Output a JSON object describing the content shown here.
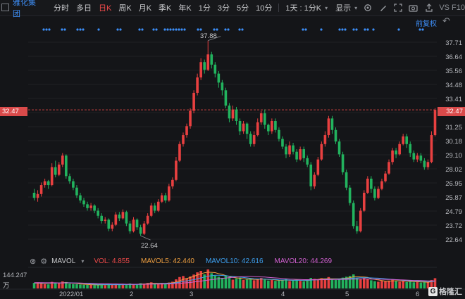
{
  "toolbar": {
    "stock_name": "雅化集团",
    "tabs": [
      "分时",
      "多日",
      "日K",
      "周K",
      "月K",
      "季K",
      "年K",
      "1分",
      "3分",
      "5分",
      "10分"
    ],
    "active_tab": "日K",
    "period_select": "1天 : 1分K",
    "display_menu": "显示",
    "f10_label": "F10",
    "vs_label": "VS"
  },
  "main_chart": {
    "adjust_label": "前复权",
    "price_ticks": [
      "37.71",
      "36.64",
      "35.56",
      "34.48",
      "33.41",
      "32.47",
      "31.25",
      "30.18",
      "29.10",
      "28.02",
      "26.95",
      "25.87",
      "24.79",
      "23.72",
      "22.64"
    ],
    "current_price": "32.47",
    "high_label": "37.88",
    "low_label": "22.64"
  },
  "indicator_bar": {
    "name": "MAVOL",
    "vol_label": "VOL: 4.855",
    "mavol5_label": "MAVOL5: 42.440",
    "mavol10_label": "MAVOL10: 42.616",
    "mavol20_label": "MAVOL20: 44.269",
    "colors": {
      "vol": "#f04a4a",
      "mavol5": "#f0a040",
      "mavol10": "#3da0f0",
      "mavol20": "#d060d0"
    }
  },
  "volume_axis": {
    "top": "144.247",
    "unit": "万"
  },
  "x_axis": [
    "2022/01",
    "2",
    "3",
    "4",
    "5",
    "6"
  ],
  "watermark": "格隆汇",
  "chart_data": {
    "type": "candlestick",
    "ylim": [
      22.1,
      38.3
    ],
    "high": 37.88,
    "low": 22.64,
    "last": 32.47,
    "candles": [
      [
        26.0,
        25.6,
        26.3,
        25.4
      ],
      [
        25.6,
        25.9,
        26.2,
        25.3
      ],
      [
        25.9,
        26.6,
        26.8,
        25.7
      ],
      [
        26.6,
        26.9,
        27.1,
        26.4
      ],
      [
        26.9,
        26.6,
        27.0,
        26.3
      ],
      [
        26.6,
        28.0,
        28.3,
        26.5
      ],
      [
        28.0,
        27.4,
        28.5,
        27.2
      ],
      [
        27.4,
        28.2,
        28.4,
        27.3
      ],
      [
        28.2,
        28.9,
        29.1,
        28.0
      ],
      [
        28.9,
        27.3,
        29.0,
        27.1
      ],
      [
        27.3,
        26.9,
        27.5,
        26.7
      ],
      [
        26.9,
        26.4,
        27.1,
        26.2
      ],
      [
        26.4,
        25.8,
        26.6,
        25.6
      ],
      [
        25.8,
        25.4,
        26.0,
        25.2
      ],
      [
        25.4,
        25.1,
        25.6,
        24.9
      ],
      [
        25.1,
        24.8,
        25.3,
        24.6
      ],
      [
        24.8,
        25.0,
        25.2,
        24.6
      ],
      [
        25.0,
        24.6,
        25.1,
        24.4
      ],
      [
        24.6,
        24.2,
        24.8,
        24.0
      ],
      [
        24.2,
        23.8,
        24.4,
        23.6
      ],
      [
        23.8,
        23.9,
        24.1,
        23.6
      ],
      [
        23.9,
        23.2,
        24.0,
        23.0
      ],
      [
        23.2,
        23.5,
        23.7,
        23.0
      ],
      [
        23.5,
        24.3,
        24.5,
        23.4
      ],
      [
        24.3,
        24.0,
        24.5,
        23.8
      ],
      [
        24.0,
        24.5,
        24.7,
        23.9
      ],
      [
        24.5,
        23.6,
        24.6,
        23.4
      ],
      [
        23.6,
        23.0,
        23.8,
        22.8
      ],
      [
        23.0,
        23.9,
        24.1,
        22.9
      ],
      [
        23.9,
        23.3,
        24.0,
        23.1
      ],
      [
        23.3,
        22.8,
        23.5,
        22.64
      ],
      [
        22.8,
        23.6,
        23.8,
        22.7
      ],
      [
        23.6,
        24.2,
        24.4,
        23.5
      ],
      [
        24.2,
        25.0,
        25.2,
        24.1
      ],
      [
        25.0,
        24.6,
        25.2,
        24.4
      ],
      [
        24.6,
        25.3,
        25.5,
        24.5
      ],
      [
        25.3,
        25.8,
        26.0,
        25.2
      ],
      [
        25.8,
        25.4,
        26.0,
        25.2
      ],
      [
        25.4,
        26.5,
        26.7,
        25.3
      ],
      [
        26.5,
        27.0,
        27.2,
        26.3
      ],
      [
        27.0,
        28.5,
        28.8,
        26.9
      ],
      [
        28.5,
        29.8,
        30.0,
        28.4
      ],
      [
        29.8,
        30.5,
        30.7,
        29.6
      ],
      [
        30.5,
        31.2,
        31.4,
        30.3
      ],
      [
        31.2,
        32.4,
        32.6,
        31.0
      ],
      [
        32.4,
        33.8,
        34.0,
        32.2
      ],
      [
        33.8,
        35.0,
        35.3,
        33.6
      ],
      [
        35.0,
        36.2,
        36.5,
        34.8
      ],
      [
        36.2,
        35.6,
        36.4,
        35.3
      ],
      [
        35.6,
        36.8,
        37.88,
        35.5
      ],
      [
        36.8,
        36.0,
        37.0,
        35.7
      ],
      [
        36.0,
        35.3,
        36.2,
        35.0
      ],
      [
        35.3,
        34.6,
        35.5,
        34.2
      ],
      [
        34.6,
        34.0,
        34.8,
        33.6
      ],
      [
        34.0,
        32.8,
        34.2,
        32.6
      ],
      [
        32.8,
        31.8,
        33.0,
        31.5
      ],
      [
        31.8,
        32.5,
        32.8,
        31.6
      ],
      [
        32.5,
        31.6,
        32.7,
        31.3
      ],
      [
        31.6,
        30.8,
        31.8,
        30.5
      ],
      [
        30.8,
        31.4,
        31.6,
        30.6
      ],
      [
        31.4,
        30.6,
        31.5,
        30.2
      ],
      [
        30.6,
        29.8,
        30.8,
        29.6
      ],
      [
        29.8,
        30.5,
        30.8,
        29.6
      ],
      [
        30.5,
        31.5,
        31.8,
        30.4
      ],
      [
        31.5,
        32.2,
        32.4,
        31.3
      ],
      [
        32.2,
        31.3,
        32.5,
        31.0
      ],
      [
        31.3,
        30.8,
        31.4,
        30.5
      ],
      [
        30.8,
        31.6,
        31.8,
        30.6
      ],
      [
        31.6,
        30.9,
        31.8,
        30.7
      ],
      [
        30.9,
        30.2,
        31.1,
        30.0
      ],
      [
        30.2,
        29.6,
        30.4,
        29.4
      ],
      [
        29.6,
        29.0,
        29.8,
        28.7
      ],
      [
        29.0,
        29.7,
        30.0,
        28.8
      ],
      [
        29.7,
        29.2,
        29.9,
        29.0
      ],
      [
        29.2,
        28.6,
        29.4,
        28.4
      ],
      [
        28.6,
        29.4,
        29.6,
        28.5
      ],
      [
        29.4,
        28.7,
        29.6,
        28.4
      ],
      [
        28.7,
        28.2,
        28.9,
        28.0
      ],
      [
        28.2,
        26.5,
        28.4,
        26.2
      ],
      [
        26.5,
        27.4,
        27.6,
        26.3
      ],
      [
        27.4,
        28.6,
        28.8,
        27.3
      ],
      [
        28.6,
        29.8,
        30.0,
        28.5
      ],
      [
        29.8,
        30.5,
        30.8,
        29.6
      ],
      [
        30.5,
        31.8,
        32.0,
        30.3
      ],
      [
        31.8,
        30.9,
        32.0,
        30.6
      ],
      [
        30.9,
        30.0,
        31.1,
        29.8
      ],
      [
        30.0,
        29.0,
        30.2,
        28.8
      ],
      [
        29.0,
        27.6,
        29.2,
        27.4
      ],
      [
        27.6,
        26.4,
        27.8,
        26.2
      ],
      [
        26.4,
        25.2,
        26.6,
        25.0
      ],
      [
        25.2,
        23.4,
        25.4,
        23.2
      ],
      [
        23.4,
        23.0,
        23.8,
        22.8
      ],
      [
        23.0,
        24.6,
        24.8,
        22.9
      ],
      [
        24.6,
        26.0,
        26.2,
        24.5
      ],
      [
        26.0,
        27.1,
        27.3,
        25.9
      ],
      [
        27.1,
        26.3,
        27.3,
        26.0
      ],
      [
        26.3,
        25.6,
        26.5,
        25.4
      ],
      [
        25.6,
        26.3,
        26.5,
        25.5
      ],
      [
        26.3,
        26.9,
        27.1,
        26.2
      ],
      [
        26.9,
        27.5,
        27.7,
        26.8
      ],
      [
        27.5,
        28.4,
        28.6,
        27.4
      ],
      [
        28.4,
        29.3,
        29.5,
        28.2
      ],
      [
        29.3,
        29.0,
        29.5,
        28.7
      ],
      [
        29.0,
        29.8,
        30.0,
        28.9
      ],
      [
        29.8,
        30.4,
        30.6,
        29.7
      ],
      [
        30.4,
        29.8,
        30.6,
        29.5
      ],
      [
        29.8,
        29.1,
        30.0,
        28.8
      ],
      [
        29.1,
        28.6,
        29.3,
        28.4
      ],
      [
        28.6,
        28.9,
        29.1,
        28.4
      ],
      [
        28.9,
        28.5,
        29.1,
        28.3
      ],
      [
        28.5,
        28.0,
        28.7,
        27.8
      ],
      [
        28.0,
        28.4,
        28.6,
        27.8
      ],
      [
        28.4,
        30.5,
        30.8,
        28.3
      ],
      [
        30.5,
        32.47,
        32.6,
        30.4
      ]
    ],
    "volumes": [
      38,
      42,
      35,
      30,
      28,
      45,
      40,
      36,
      48,
      44,
      33,
      30,
      29,
      27,
      25,
      24,
      26,
      23,
      25,
      28,
      22,
      30,
      26,
      32,
      28,
      24,
      30,
      34,
      29,
      26,
      36,
      32,
      38,
      42,
      30,
      34,
      38,
      30,
      40,
      46,
      62,
      78,
      85,
      70,
      82,
      95,
      110,
      120,
      96,
      130,
      104,
      88,
      80,
      72,
      90,
      76,
      60,
      68,
      74,
      58,
      62,
      70,
      56,
      64,
      72,
      60,
      54,
      58,
      52,
      56,
      60,
      64,
      50,
      54,
      58,
      52,
      48,
      56,
      72,
      66,
      60,
      70,
      64,
      78,
      62,
      58,
      66,
      74,
      80,
      86,
      96,
      70,
      62,
      74,
      66,
      56,
      50,
      46,
      52,
      48,
      54,
      60,
      50,
      46,
      52,
      44,
      48,
      42,
      46,
      40,
      44,
      42,
      58,
      70
    ],
    "mavol5": [
      36,
      36,
      35,
      35,
      35,
      36,
      38,
      38,
      39,
      41,
      38,
      36,
      34,
      31,
      29,
      27,
      26,
      25,
      24,
      25,
      25,
      26,
      26,
      27,
      27,
      27,
      28,
      28,
      28,
      29,
      30,
      31,
      32,
      34,
      35,
      35,
      35,
      35,
      37,
      38,
      44,
      52,
      62,
      68,
      75,
      82,
      92,
      100,
      107,
      111,
      110,
      108,
      101,
      96,
      88,
      81,
      76,
      72,
      70,
      66,
      64,
      64,
      62,
      62,
      64,
      64,
      61,
      61,
      58,
      56,
      56,
      58,
      56,
      56,
      57,
      56,
      54,
      54,
      57,
      60,
      62,
      66,
      66,
      67,
      66,
      66,
      66,
      68,
      70,
      73,
      80,
      80,
      79,
      78,
      76,
      66,
      62,
      58,
      54,
      50,
      50,
      52,
      53,
      52,
      52,
      49,
      48,
      46,
      46,
      44,
      44,
      42,
      46,
      51
    ],
    "mavol10": [
      38,
      38,
      37,
      37,
      37,
      37,
      37,
      37,
      38,
      39,
      39,
      38,
      37,
      36,
      35,
      33,
      31,
      29,
      28,
      28,
      27,
      27,
      26,
      26,
      26,
      26,
      27,
      27,
      27,
      27,
      28,
      29,
      30,
      31,
      31,
      32,
      33,
      34,
      35,
      36,
      39,
      43,
      48,
      52,
      56,
      60,
      66,
      72,
      78,
      84,
      87,
      90,
      90,
      89,
      87,
      84,
      82,
      80,
      78,
      75,
      72,
      69,
      66,
      65,
      65,
      64,
      63,
      62,
      61,
      59,
      58,
      58,
      57,
      56,
      56,
      56,
      56,
      56,
      57,
      58,
      59,
      60,
      62,
      63,
      63,
      64,
      65,
      66,
      67,
      68,
      70,
      72,
      73,
      73,
      73,
      72,
      71,
      70,
      68,
      66,
      64,
      62,
      60,
      58,
      56,
      54,
      53,
      52,
      51,
      50,
      49,
      48,
      48,
      49
    ],
    "mavol20": [
      40,
      40,
      40,
      39,
      39,
      39,
      39,
      38,
      38,
      38,
      38,
      37,
      37,
      37,
      36,
      36,
      35,
      34,
      33,
      33,
      32,
      32,
      31,
      31,
      30,
      30,
      29,
      29,
      29,
      29,
      29,
      29,
      29,
      30,
      30,
      30,
      30,
      31,
      31,
      32,
      33,
      35,
      37,
      39,
      41,
      44,
      47,
      50,
      54,
      57,
      60,
      63,
      66,
      69,
      71,
      74,
      76,
      78,
      80,
      81,
      82,
      82,
      81,
      80,
      79,
      78,
      76,
      74,
      72,
      70,
      68,
      66,
      64,
      63,
      62,
      61,
      60,
      60,
      60,
      60,
      60,
      60,
      60,
      60,
      61,
      61,
      61,
      62,
      62,
      63,
      64,
      64,
      65,
      65,
      65,
      64,
      64,
      63,
      63,
      62,
      61,
      61,
      60,
      59,
      58,
      57,
      56,
      55,
      55,
      54,
      53,
      52,
      52,
      52
    ]
  }
}
